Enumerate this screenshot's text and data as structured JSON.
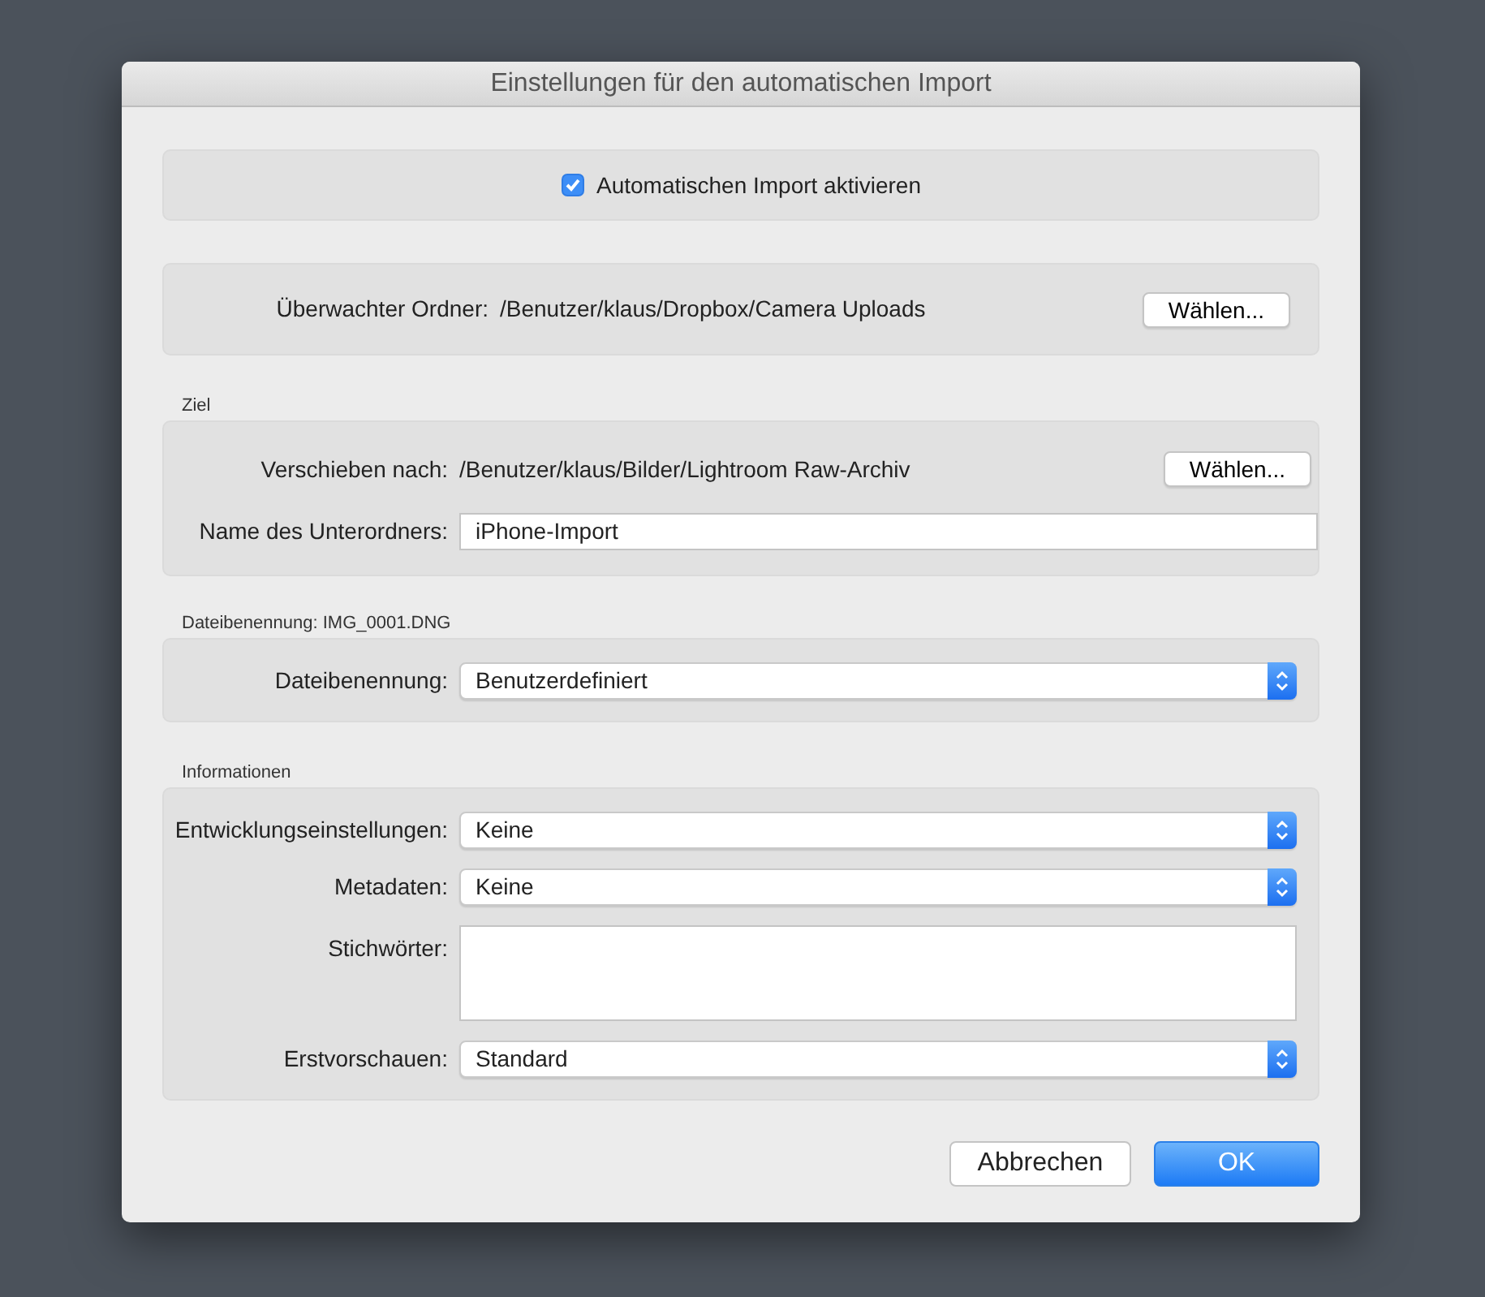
{
  "window": {
    "title": "Einstellungen für den automatischen Import"
  },
  "auto_import": {
    "label": "Automatischen Import aktivieren",
    "checked": true
  },
  "watched_folder": {
    "label": "Überwachter Ordner:",
    "path": "/Benutzer/klaus/Dropbox/Camera Uploads",
    "button": "Wählen..."
  },
  "destination": {
    "heading": "Ziel",
    "move_to": {
      "label": "Verschieben nach:",
      "path": "/Benutzer/klaus/Bilder/Lightroom Raw-Archiv",
      "button": "Wählen..."
    },
    "subfolder": {
      "label": "Name des Unterordners:",
      "value": "iPhone-Import"
    }
  },
  "file_naming": {
    "heading": "Dateibenennung: IMG_0001.DNG",
    "field": {
      "label": "Dateibenennung:",
      "value": "Benutzerdefiniert"
    }
  },
  "information": {
    "heading": "Informationen",
    "fields": [
      {
        "kind": "select",
        "label": "Entwicklungseinstellungen:",
        "value": "Keine"
      },
      {
        "kind": "select",
        "label": "Metadaten:",
        "value": "Keine"
      },
      {
        "kind": "textarea",
        "label": "Stichwörter:"
      },
      {
        "kind": "select",
        "label": "Erstvorschauen:",
        "value": "Standard"
      }
    ]
  },
  "buttons": [
    {
      "label": "Abbrechen",
      "default": false
    },
    {
      "label": "OK",
      "default": true
    }
  ]
}
